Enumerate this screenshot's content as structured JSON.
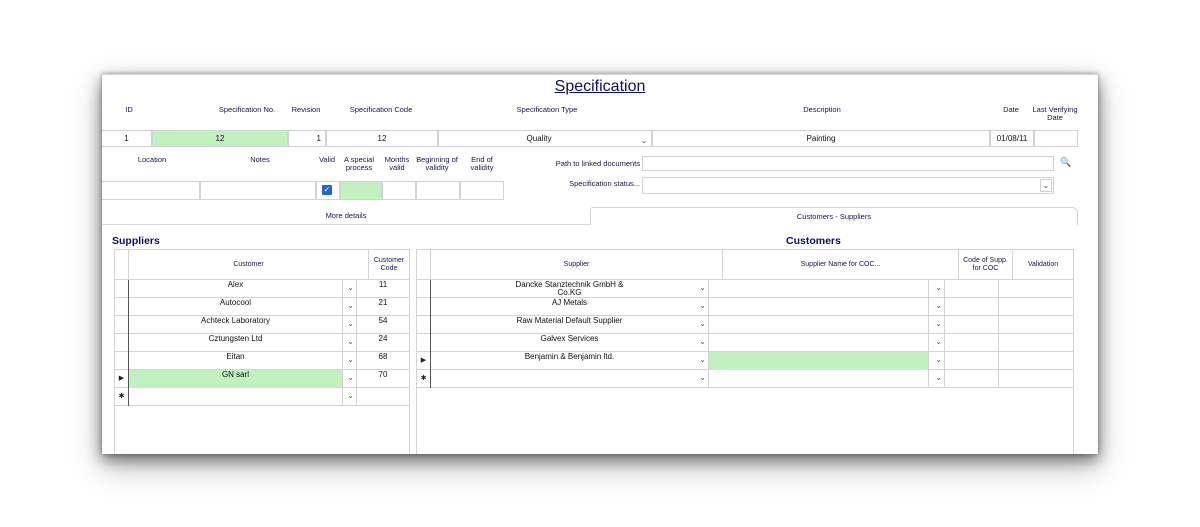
{
  "title": "Specification",
  "header_labels": {
    "id": "ID",
    "spec_no": "Specification No.",
    "revision": "Revision",
    "spec_code": "Specification Code",
    "spec_type": "Specification Type",
    "description": "Description",
    "date": "Date",
    "last_verifying_date": "Last Verifying Date"
  },
  "header_values": {
    "id": "1",
    "spec_no": "12",
    "revision": "1",
    "spec_code": "12",
    "spec_type": "Quality",
    "description": "Painting",
    "date": "01/08/11",
    "last_verifying_date": ""
  },
  "row2_labels": {
    "location": "Location",
    "notes": "Notes",
    "valid": "Valid",
    "special_process": "A special process",
    "months_valid": "Months valid",
    "beginning_validity": "Beginning of validity",
    "end_validity": "End of validity",
    "path_linked_docs": "Path to linked documents",
    "spec_status": "Specification status..."
  },
  "row2_values": {
    "location": "",
    "notes": "",
    "valid_checked": true,
    "special_process": "",
    "months_valid": "",
    "beginning_validity": "",
    "end_validity": "",
    "path_linked_docs": "",
    "spec_status": ""
  },
  "tabs": [
    {
      "label": "More details",
      "active": false
    },
    {
      "label": "Customers - Suppliers",
      "active": true
    }
  ],
  "suppliers_panel": {
    "title": "Suppliers",
    "columns": [
      "Customer",
      "Customer Code"
    ],
    "rows": [
      {
        "customer": "Alex",
        "code": "11",
        "current": false
      },
      {
        "customer": "Autocool",
        "code": "21",
        "current": false
      },
      {
        "customer": "Achteck Laboratory",
        "code": "54",
        "current": false
      },
      {
        "customer": "Cztungsten Ltd",
        "code": "24",
        "current": false
      },
      {
        "customer": "Eitan",
        "code": "68",
        "current": false
      },
      {
        "customer": "GN sarl",
        "code": "70",
        "current": true
      }
    ]
  },
  "customers_panel": {
    "title": "Customers",
    "columns": [
      "Supplier",
      "Supplier Name for COC...",
      "Code of Supp. for COC",
      "Validation"
    ],
    "rows": [
      {
        "supplier": "Dancke Stanztechnik GmbH & Co.KG",
        "name_coc": "",
        "code_coc": "",
        "validation": "",
        "current": false
      },
      {
        "supplier": "AJ Metals",
        "name_coc": "",
        "code_coc": "",
        "validation": "",
        "current": false
      },
      {
        "supplier": "Raw Material Default Supplier",
        "name_coc": "",
        "code_coc": "",
        "validation": "",
        "current": false
      },
      {
        "supplier": "Galvex Services",
        "name_coc": "",
        "code_coc": "",
        "validation": "",
        "current": false
      },
      {
        "supplier": "Benjamin & Benjamin ltd.",
        "name_coc": "",
        "code_coc": "",
        "validation": "",
        "current": true
      }
    ]
  },
  "glyphs": {
    "dropdown": "⌄",
    "current_row": "▶",
    "new_row": "✱",
    "check": "✓",
    "search": "🔍"
  },
  "colors": {
    "title": "#0d0d60",
    "highlight": "#c2f1c0",
    "checkbox": "#2568c4"
  }
}
